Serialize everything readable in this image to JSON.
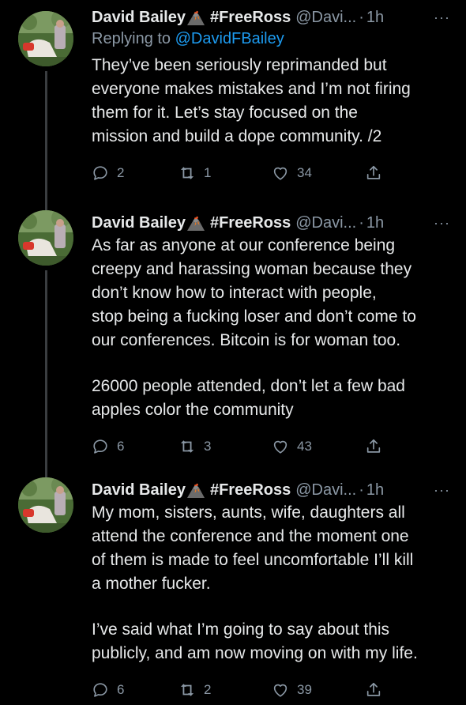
{
  "colors": {
    "background": "#000000",
    "text": "#e7e9ea",
    "muted": "#8b98a5",
    "link": "#1d9bf0",
    "thread_line": "#3a3d40"
  },
  "tweets": [
    {
      "name": "David Bailey",
      "emoji": "volcano-emoji",
      "tag": "#FreeRoss",
      "handle": "@Davi...",
      "dot": "·",
      "time": "1h",
      "more": "···",
      "replying_prefix": "Replying to",
      "replying_handle": "@DavidFBailey",
      "paragraphs": [
        [
          "They’ve been seriously reprimanded but",
          "everyone makes mistakes and I’m not firing",
          "them for it. Let’s stay focused on the",
          "mission and build a dope community. /2"
        ]
      ],
      "replies": "2",
      "retweets": "1",
      "likes": "34"
    },
    {
      "name": "David Bailey",
      "emoji": "volcano-emoji",
      "tag": "#FreeRoss",
      "handle": "@Davi...",
      "dot": "·",
      "time": "1h",
      "more": "···",
      "paragraphs": [
        [
          "As far as anyone at our conference being",
          "creepy and harassing woman because they",
          "don’t know how to interact with people,",
          "stop being a fucking loser and don’t come to",
          "our conferences. Bitcoin is for woman too."
        ],
        [
          "26000 people attended, don’t let a few bad",
          "apples color the community"
        ]
      ],
      "replies": "6",
      "retweets": "3",
      "likes": "43"
    },
    {
      "name": "David Bailey",
      "emoji": "volcano-emoji",
      "tag": "#FreeRoss",
      "handle": "@Davi...",
      "dot": "·",
      "time": "1h",
      "more": "···",
      "paragraphs": [
        [
          "My mom, sisters, aunts, wife, daughters all",
          "attend the conference and the moment one",
          "of them is made to feel uncomfortable I’ll kill",
          "a mother fucker."
        ],
        [
          "I’ve said what I’m going to say about this",
          "publicly, and am now moving on with my life."
        ]
      ],
      "replies": "6",
      "retweets": "2",
      "likes": "39"
    }
  ]
}
